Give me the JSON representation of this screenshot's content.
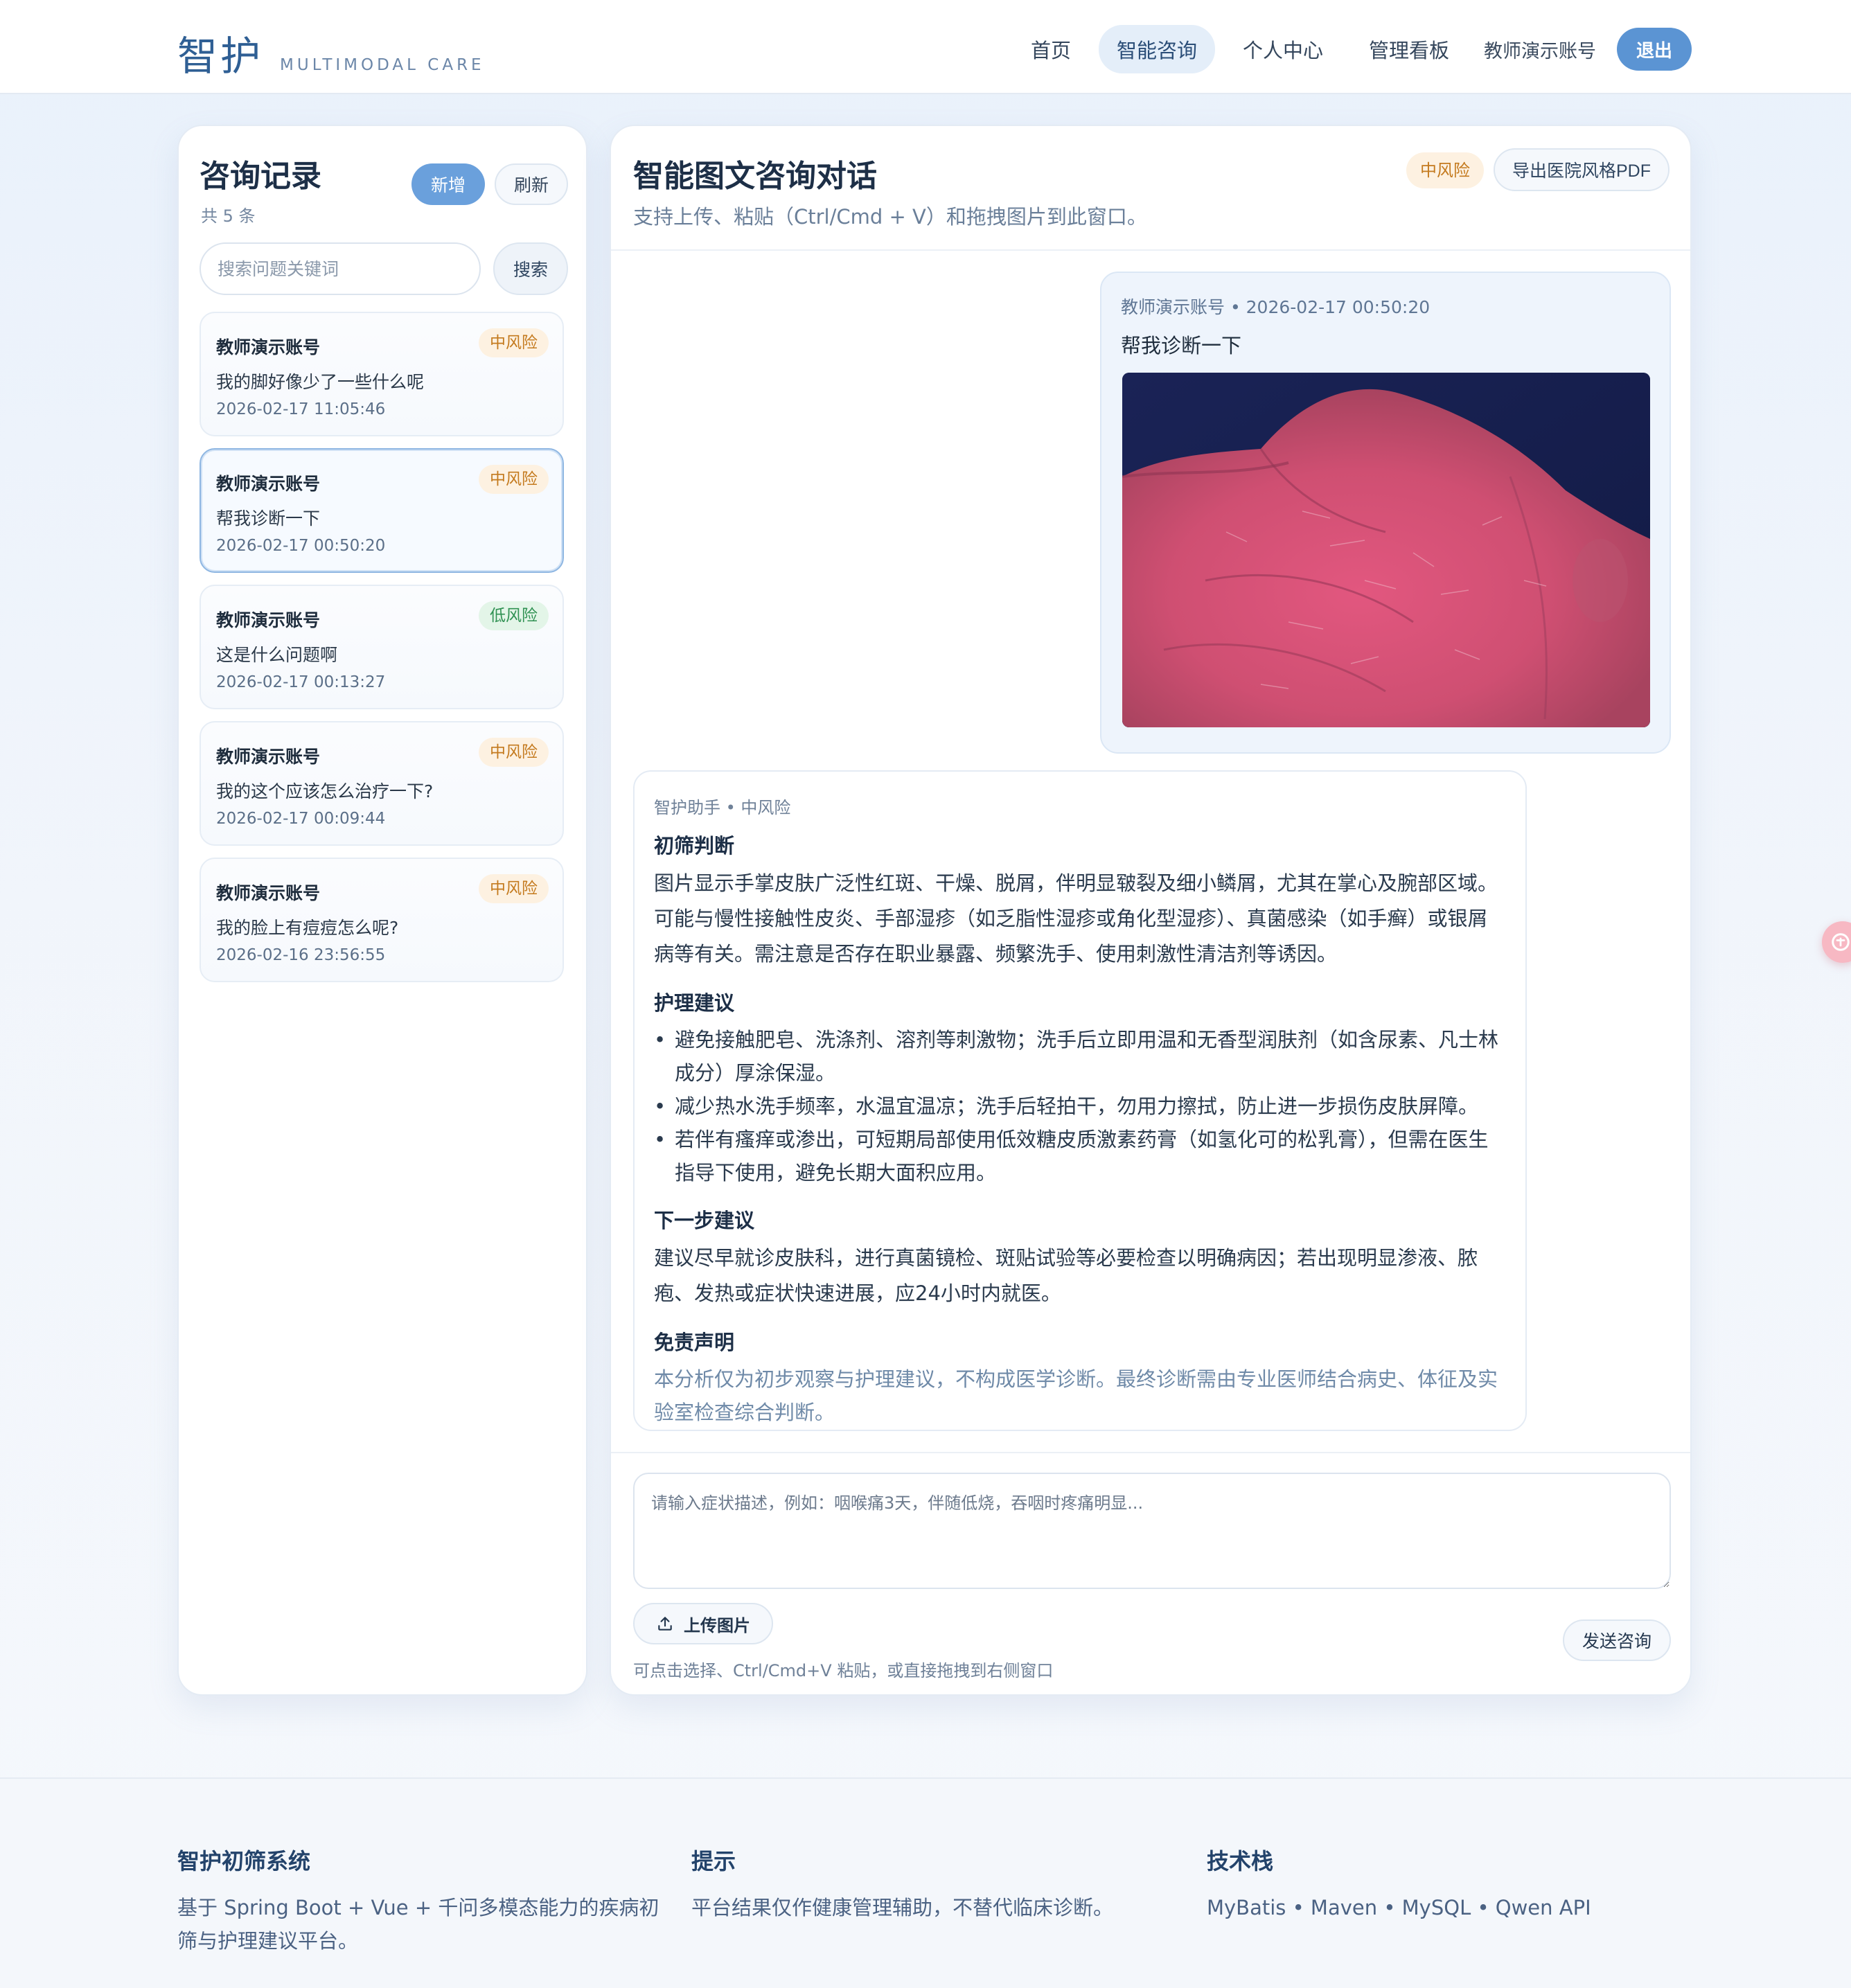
{
  "header": {
    "brand_cn": "智护",
    "brand_en": "MULTIMODAL CARE",
    "nav": [
      "首页",
      "智能咨询",
      "个人中心",
      "管理看板"
    ],
    "user": "教师演示账号",
    "logout": "退出"
  },
  "sidebar": {
    "title": "咨询记录",
    "count": "共 5 条",
    "new_label": "新增",
    "refresh_label": "刷新",
    "search_placeholder": "搜索问题关键词",
    "search_label": "搜索",
    "records": [
      {
        "user": "教师演示账号",
        "risk": "中风险",
        "question": "我的脚好像少了一些什么呢",
        "time": "2026-02-17 11:05:46"
      },
      {
        "user": "教师演示账号",
        "risk": "中风险",
        "question": "帮我诊断一下",
        "time": "2026-02-17 00:50:20"
      },
      {
        "user": "教师演示账号",
        "risk": "低风险",
        "question": "这是什么问题啊",
        "time": "2026-02-17 00:13:27"
      },
      {
        "user": "教师演示账号",
        "risk": "中风险",
        "question": "我的这个应该怎么治疗一下?",
        "time": "2026-02-17 00:09:44"
      },
      {
        "user": "教师演示账号",
        "risk": "中风险",
        "question": "我的脸上有痘痘怎么呢?",
        "time": "2026-02-16 23:56:55"
      }
    ]
  },
  "chat": {
    "title": "智能图文咨询对话",
    "subtitle": "支持上传、粘贴（Ctrl/Cmd + V）和拖拽图片到此窗口。",
    "risk_badge": "中风险",
    "export_label": "导出医院风格PDF",
    "user_message": {
      "meta": "教师演示账号 • 2026-02-17 00:50:20",
      "text": "帮我诊断一下"
    },
    "assistant_message": {
      "meta": "智护助手 • 中风险",
      "h1": "初筛判断",
      "p1": "图片显示手掌皮肤广泛性红斑、干燥、脱屑，伴明显皲裂及细小鳞屑，尤其在掌心及腕部区域。可能与慢性接触性皮炎、手部湿疹（如乏脂性湿疹或角化型湿疹）、真菌感染（如手癣）或银屑病等有关。需注意是否存在职业暴露、频繁洗手、使用刺激性清洁剂等诱因。",
      "h2": "护理建议",
      "tips": [
        "避免接触肥皂、洗涤剂、溶剂等刺激物；洗手后立即用温和无香型润肤剂（如含尿素、凡士林成分）厚涂保湿。",
        "减少热水洗手频率，水温宜温凉；洗手后轻拍干，勿用力擦拭，防止进一步损伤皮肤屏障。",
        "若伴有瘙痒或渗出，可短期局部使用低效糖皮质激素药膏（如氢化可的松乳膏），但需在医生指导下使用，避免长期大面积应用。"
      ],
      "h3": "下一步建议",
      "p3": "建议尽早就诊皮肤科，进行真菌镜检、斑贴试验等必要检查以明确病因；若出现明显渗液、脓疱、发热或症状快速进展，应24小时内就医。",
      "h4": "免责声明",
      "p4": "本分析仅为初步观察与护理建议，不构成医学诊断。最终诊断需由专业医师结合病史、体征及实验室检查综合判断。"
    },
    "input_placeholder": "请输入症状描述，例如：咽喉痛3天，伴随低烧，吞咽时疼痛明显...",
    "upload_label": "上传图片",
    "upload_hint": "可点击选择、Ctrl/Cmd+V 粘贴，或直接拖拽到右侧窗口",
    "send_label": "发送咨询"
  },
  "footer": {
    "col1_title": "智护初筛系统",
    "col1_text": "基于 Spring Boot + Vue + 千问多模态能力的疾病初筛与护理建议平台。",
    "col2_title": "提示",
    "col2_text": "平台结果仅作健康管理辅助，不替代临床诊断。",
    "col3_title": "技术栈",
    "col3_text": "MyBatis • Maven • MySQL • Qwen API"
  },
  "colors": {
    "accent": "#5b94d3",
    "risk_mid_bg": "#fdf1e1",
    "risk_mid_text": "#c47a1e",
    "risk_low_bg": "#e3f5e8",
    "risk_low_text": "#2f9152"
  }
}
